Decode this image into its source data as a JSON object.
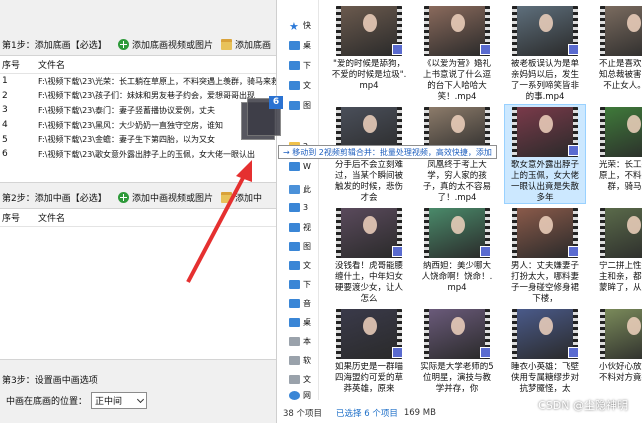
{
  "app": {
    "step1": {
      "title": "第1步：添加底画【必选】",
      "add_video": "添加底画视频或图片",
      "add_folder": "添加底画"
    },
    "table1": {
      "headers": {
        "index": "序号",
        "name": "文件名"
      },
      "rows": [
        {
          "index": "1",
          "name": "F:\\视频下载\\23\\光荣：长工躺在草原上，不料突遇上羡群，骑马来救"
        },
        {
          "index": "2",
          "name": "F:\\视频下载\\23\\孩子们：妹妹和男友巷子约会，爱想哥哥出现"
        },
        {
          "index": "3",
          "name": "F:\\视频下载\\23\\泰门：妻子竖蓄播协议爱例，丈夫"
        },
        {
          "index": "4",
          "name": "F:\\视频下载\\23\\黑风：大少奶奶一直独守空房，谁知"
        },
        {
          "index": "5",
          "name": "F:\\视频下载\\23\\金蟾：妻子生下第四胎，以为又女"
        },
        {
          "index": "6",
          "name": "F:\\视频下载\\23\\歌女意外露出脖子上的玉佩，女大佬一眼认出"
        }
      ]
    },
    "step2": {
      "title": "第2步：添加中画【必选】",
      "add_video": "添加中画视频或图片",
      "add_folder": "添加中"
    },
    "table2": {
      "headers": {
        "index": "序号",
        "name": "文件名"
      }
    },
    "step3": {
      "title": "第3步：设置画中画选项"
    },
    "position_option": {
      "label": "中画在底画的位置：",
      "value": "正中间"
    }
  },
  "drag": {
    "count": "6",
    "tooltip": "→ 移动到 2视频剪辑合并：批量处理视频，高效快捷，添加"
  },
  "explorer": {
    "nav": [
      {
        "label": "快",
        "icon": "star-icon"
      },
      {
        "label": "桌",
        "icon": "desktop-icon"
      },
      {
        "label": "下",
        "icon": "download-icon"
      },
      {
        "label": "文",
        "icon": "documents-icon"
      },
      {
        "label": "图",
        "icon": "pictures-icon"
      },
      {
        "label": "2",
        "icon": "folder-icon"
      },
      {
        "label": "W",
        "icon": "onedrive-icon"
      },
      {
        "label": "此",
        "icon": "this-pc-icon"
      },
      {
        "label": "3",
        "icon": "3d-objects-icon"
      },
      {
        "label": "视",
        "icon": "videos-icon"
      },
      {
        "label": "图",
        "icon": "pictures-icon"
      },
      {
        "label": "文",
        "icon": "documents-icon"
      },
      {
        "label": "下",
        "icon": "download-icon"
      },
      {
        "label": "音",
        "icon": "music-icon"
      },
      {
        "label": "桌",
        "icon": "desktop-icon"
      },
      {
        "label": "本",
        "icon": "drive-icon"
      },
      {
        "label": "软",
        "icon": "drive-icon"
      },
      {
        "label": "文",
        "icon": "drive-icon"
      },
      {
        "label": "网",
        "icon": "network-icon"
      }
    ],
    "files": [
      {
        "name": "\"爱的时候是舔狗，不爱的时候是垃圾\".mp4",
        "selected": false,
        "color": "#6b5a4e"
      },
      {
        "name": "《以爱为营》婚礼上书意说了什么逗的台下人哈哈大笑！.mp4",
        "selected": false,
        "color": "#8a6a5c"
      },
      {
        "name": "被老板误认为是单亲妈妈以后，发生了一系列啼笑皆非的事.mp4",
        "selected": false,
        "color": "#5e6f7c"
      },
      {
        "name": "不止是喜欢，妹得知总裁被害，以为不止女人。听完",
        "selected": false,
        "color": "#7a6b5f"
      },
      {
        "name": "分手后不会立刻难过，当某个瞬间被触发的时候，悲伤才会",
        "selected": false,
        "color": "#4a4f5a"
      },
      {
        "name": "凤凰终于考上大学，穷人家的孩子，真的太不容易了！.mp4",
        "selected": false,
        "color": "#8c7b6a"
      },
      {
        "name": "歌女意外露出脖子上的玉佩，女大佬一眼认出竟是失散多年",
        "selected": true,
        "color": "#7a3a4a"
      },
      {
        "name": "光荣：长工躺在草原上，不料遇上羡群，骑马来救",
        "selected": false,
        "color": "#3f7a3a"
      },
      {
        "name": "没钱看！虎哥能腰缠什土，中年妇女硬要渡少女，让人怎么",
        "selected": false,
        "color": "#5a4a5c"
      },
      {
        "name": "纳西妲：美少哪大人饶命啊！饶命！.mp4",
        "selected": false,
        "color": "#4a8a6a"
      },
      {
        "name": "男人：丈夫嫌妻子打扮太大，哪料妻子一身碰空修身裙下楼，",
        "selected": false,
        "color": "#8a5a4a"
      },
      {
        "name": "宁二拼上性命止公主和亲，都被和被蒙眸了，从此又能",
        "selected": false,
        "color": "#5a6a4a"
      },
      {
        "name": "如果历史是一群喵四海盟约可爱的草莽英雄，原来",
        "selected": false,
        "color": "#3a3a4a"
      },
      {
        "name": "实际是大学老师的5位明星，演技与教学并存，你",
        "selected": false,
        "color": "#6a5a7a"
      },
      {
        "name": "睡衣小英雄：飞壁侠用专属糖缪步对抗梦魇怪，太",
        "selected": false,
        "color": "#4a5a8a"
      },
      {
        "name": "小伙好心放了鱼，不料对方竟报恩了",
        "selected": false,
        "color": "#7a8a5a"
      }
    ],
    "status": {
      "count": "38 个项目",
      "selected": "已选择 6 个项目",
      "size": "169 MB"
    }
  },
  "watermark": "CSDN @尘隐神明"
}
